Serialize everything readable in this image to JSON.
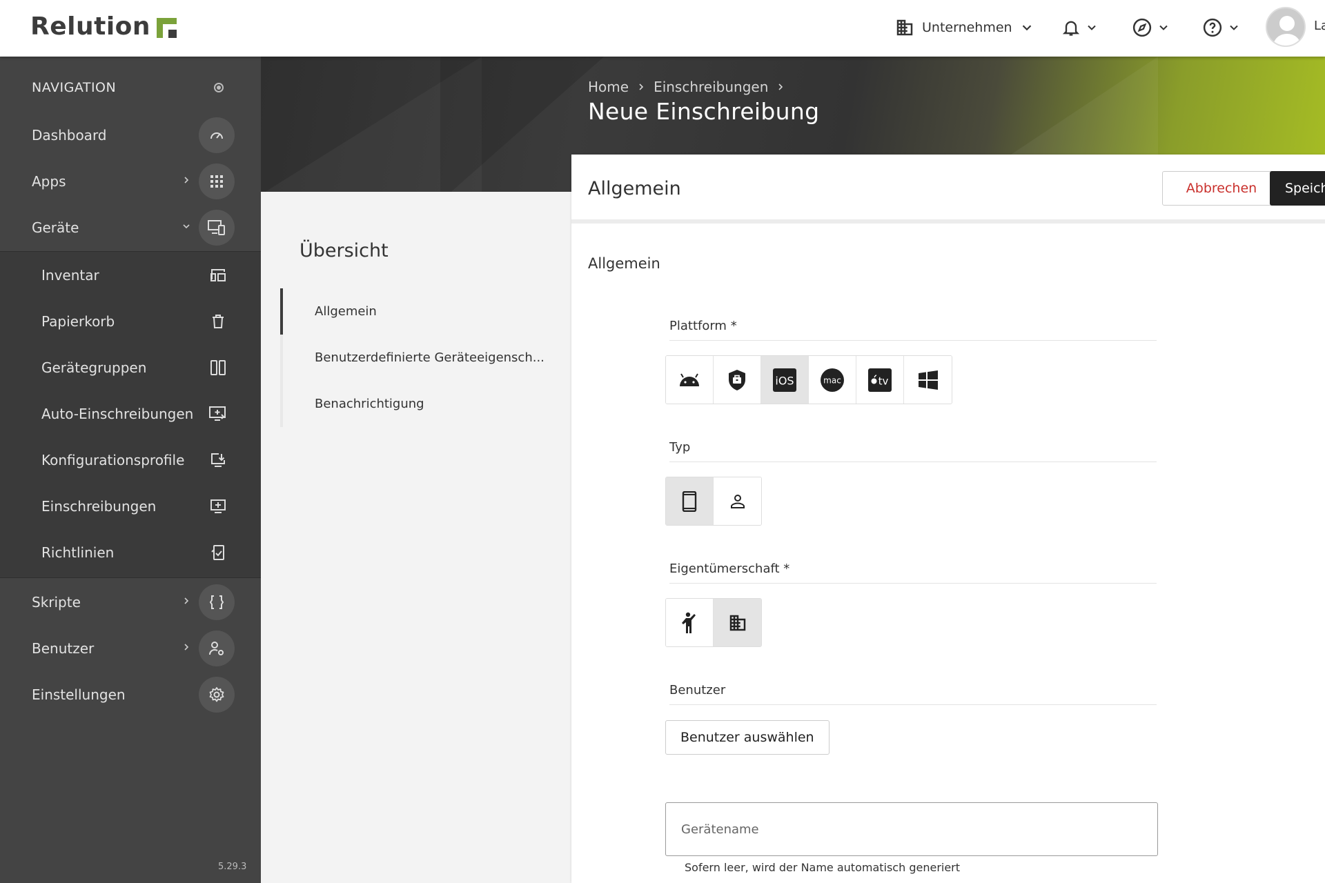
{
  "brand": {
    "name": "Relution"
  },
  "topbar": {
    "org_label": "Unternehmen",
    "user_name": "La"
  },
  "sidebar": {
    "heading": "NAVIGATION",
    "items": [
      {
        "label": "Dashboard",
        "icon": "gauge-icon"
      },
      {
        "label": "Apps",
        "icon": "apps-grid-icon"
      },
      {
        "label": "Geräte",
        "icon": "devices-icon"
      }
    ],
    "sub_items": [
      {
        "label": "Inventar",
        "icon": "inventory-icon"
      },
      {
        "label": "Papierkorb",
        "icon": "trash-icon"
      },
      {
        "label": "Gerätegruppen",
        "icon": "device-groups-icon"
      },
      {
        "label": "Auto-Einschreibungen",
        "icon": "auto-enroll-icon"
      },
      {
        "label": "Konfigurationsprofile",
        "icon": "config-profile-icon"
      },
      {
        "label": "Einschreibungen",
        "icon": "enrollment-icon"
      },
      {
        "label": "Richtlinien",
        "icon": "policy-icon"
      }
    ],
    "bottom_items": [
      {
        "label": "Skripte",
        "icon": "braces-icon"
      },
      {
        "label": "Benutzer",
        "icon": "user-settings-icon"
      },
      {
        "label": "Einstellungen",
        "icon": "gear-icon"
      }
    ],
    "version": "5.29.3"
  },
  "header": {
    "breadcrumb": [
      "Home",
      "Einschreibungen"
    ],
    "title": "Neue Einschreibung"
  },
  "overview": {
    "title": "Übersicht",
    "items": [
      {
        "label": "Allgemein"
      },
      {
        "label": "Benutzerdefinierte Geräteeigensch..."
      },
      {
        "label": "Benachrichtigung"
      }
    ]
  },
  "panel": {
    "title": "Allgemein",
    "cancel_label": "Abbrechen",
    "save_label": "Speichern",
    "section_title": "Allgemein",
    "platform_label": "Plattform *",
    "platforms": [
      "android",
      "android-enterprise",
      "iOS",
      "mac",
      "tv",
      "windows"
    ],
    "platform_selected": "iOS",
    "type_label": "Typ",
    "types": [
      "device",
      "user"
    ],
    "type_selected": "device",
    "ownership_label": "Eigentümerschaft *",
    "ownerships": [
      "personal",
      "company"
    ],
    "ownership_selected": "company",
    "user_label": "Benutzer",
    "select_user_label": "Benutzer auswählen",
    "device_name_placeholder": "Gerätename",
    "device_name_value": "",
    "device_name_hint": "Sofern leer, wird der Name automatisch generiert"
  }
}
